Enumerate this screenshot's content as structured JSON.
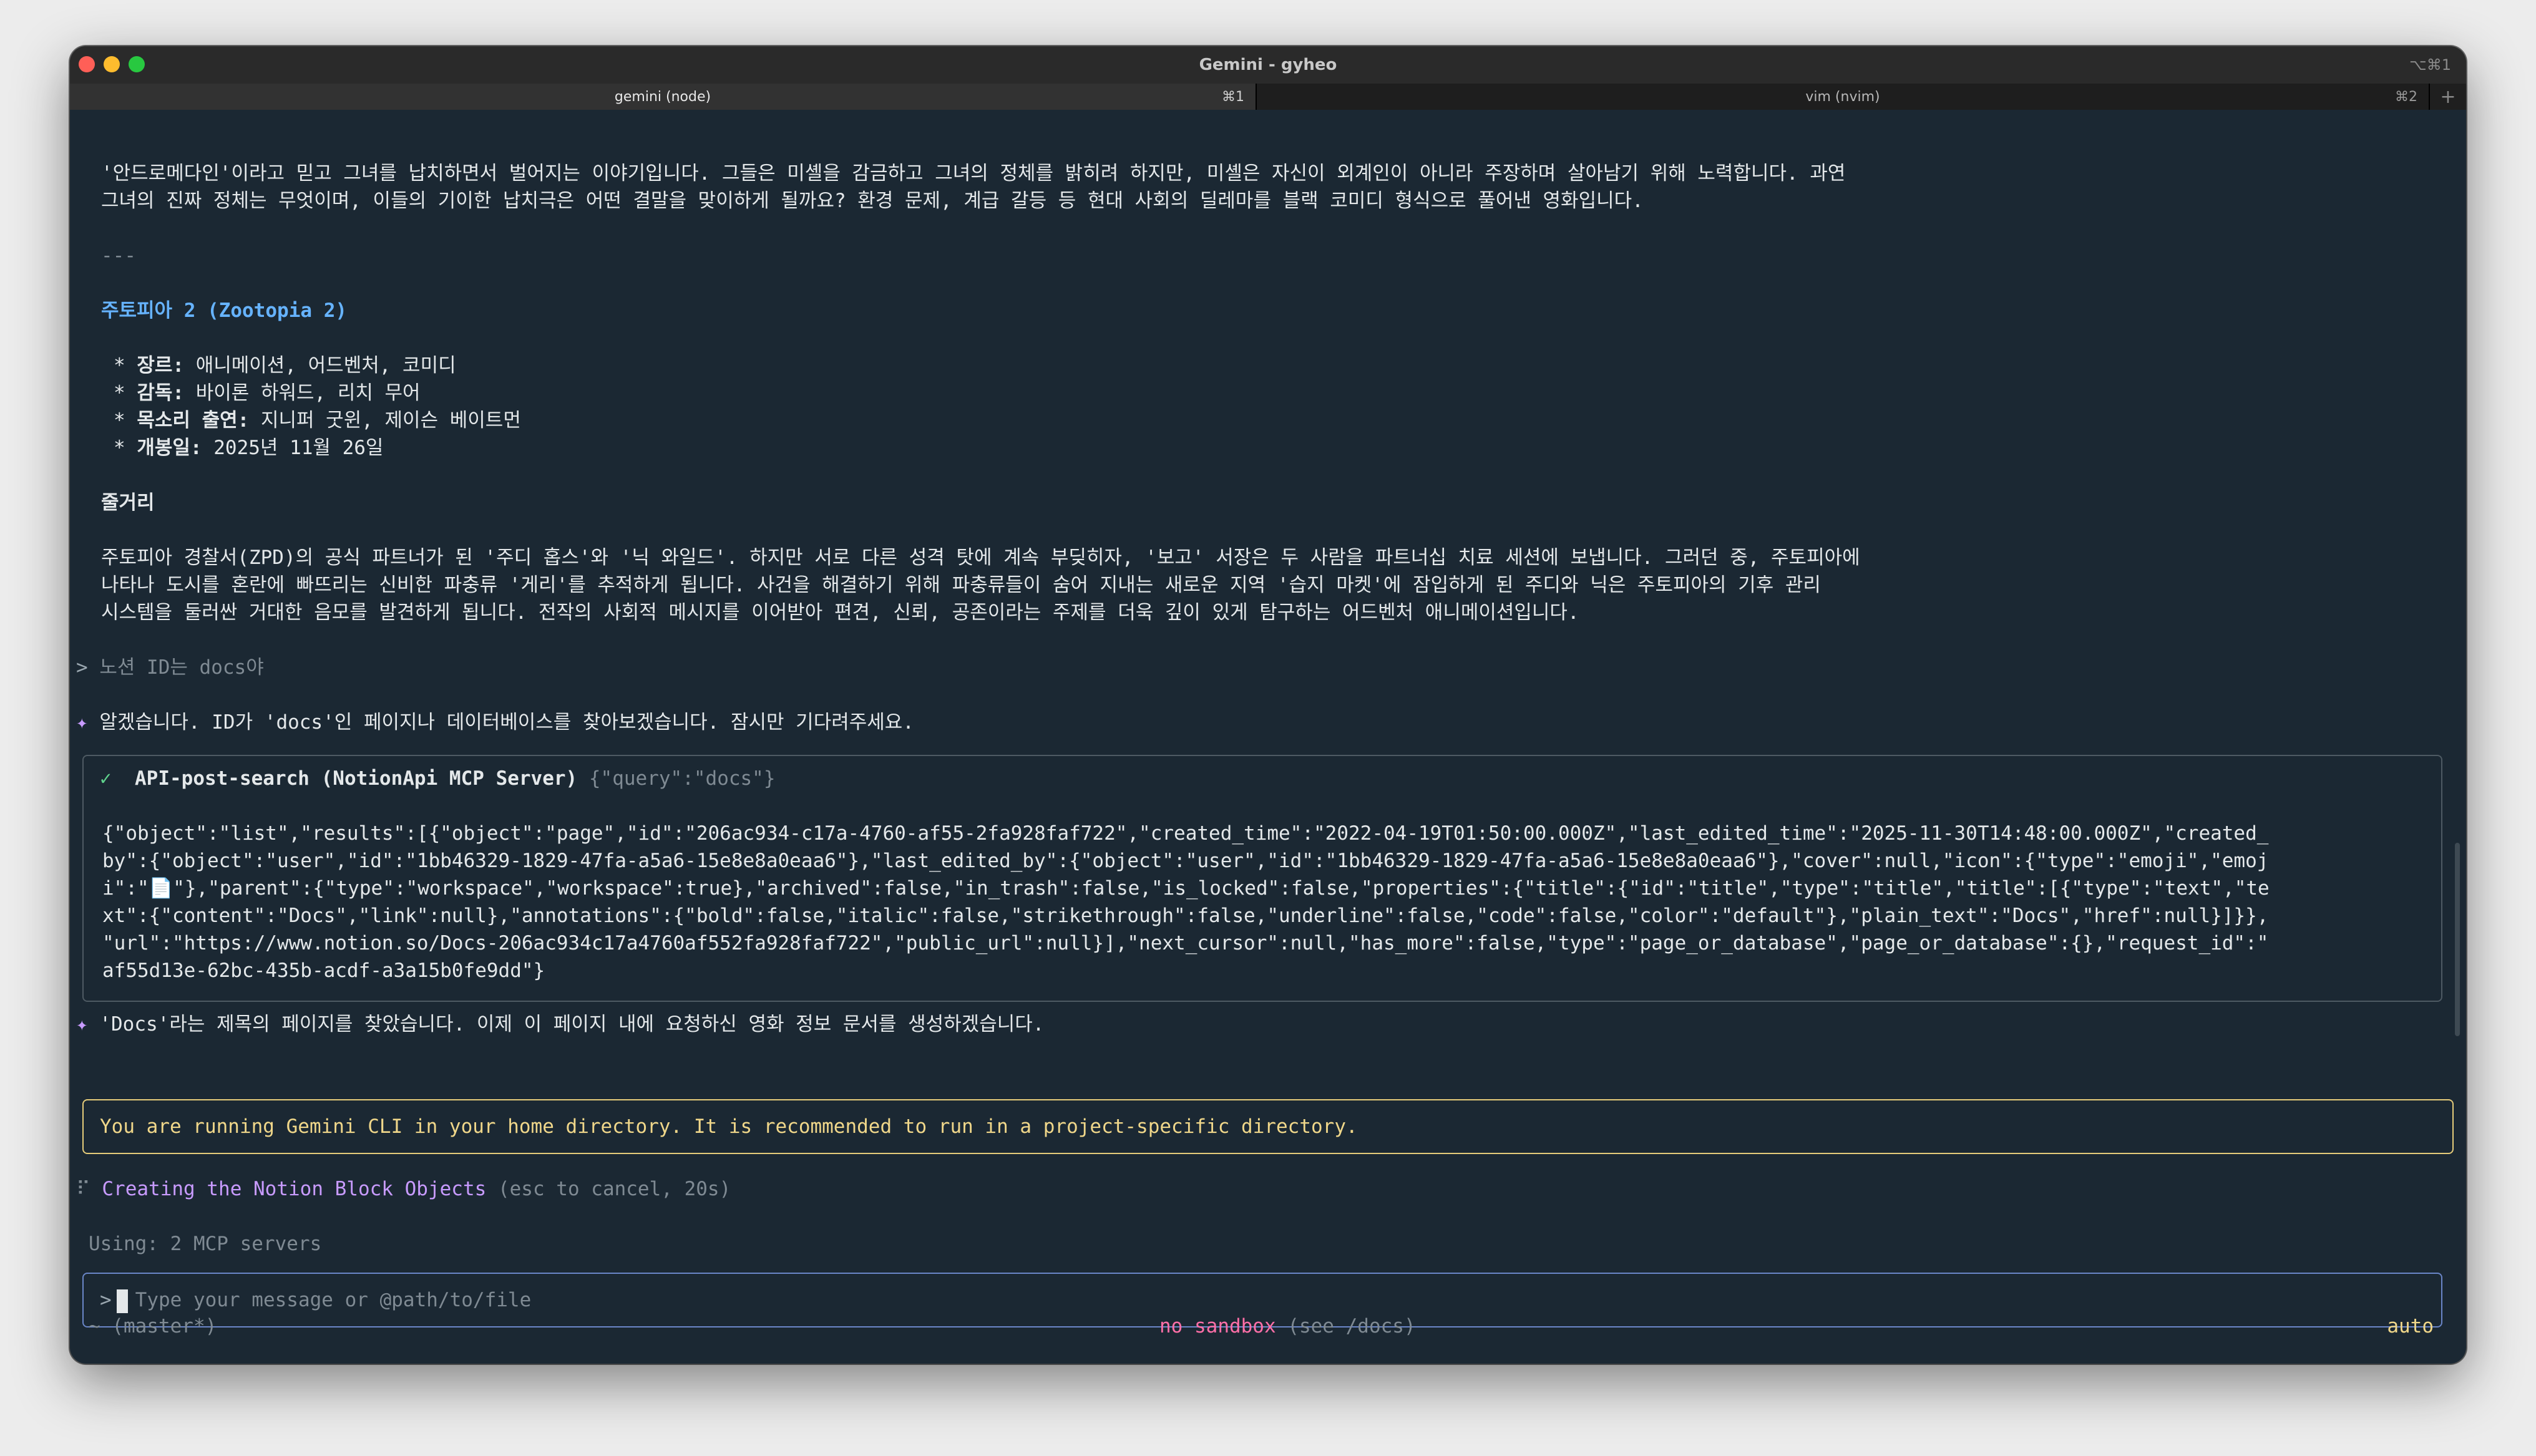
{
  "window": {
    "title": "Gemini - gyheo",
    "title_shortcut": "⌥⌘1"
  },
  "tabs": [
    {
      "label": "gemini (node)",
      "key": "⌘1",
      "active": true
    },
    {
      "label": "vim (nvim)",
      "key": "⌘2",
      "active": false
    }
  ],
  "new_tab_label": "+",
  "content": {
    "intro_line1": "'안드로메다인'이라고 믿고 그녀를 납치하면서 벌어지는 이야기입니다. 그들은 미셸을 감금하고 그녀의 정체를 밝히려 하지만, 미셸은 자신이 외계인이 아니라 주장하며 살아남기 위해 노력합니다. 과연",
    "intro_line2": "그녀의 진짜 정체는 무엇이며, 이들의 기이한 납치극은 어떤 결말을 맞이하게 될까요? 환경 문제, 계급 갈등 등 현대 사회의 딜레마를 블랙 코미디 형식으로 풀어낸 영화입니다.",
    "divider": "---",
    "movie_title": "주토피아 2 (Zootopia 2)",
    "details": [
      {
        "bullet": "*",
        "label": "장르:",
        "value": " 애니메이션, 어드벤처, 코미디"
      },
      {
        "bullet": "*",
        "label": "감독:",
        "value": " 바이론 하워드, 리치 무어"
      },
      {
        "bullet": "*",
        "label": "목소리 출연:",
        "value": " 지니퍼 굿윈, 제이슨 베이트먼"
      },
      {
        "bullet": "*",
        "label": "개봉일:",
        "value": " 2025년 11월 26일"
      }
    ],
    "plot_heading": "줄거리",
    "plot_lines": [
      "주토피아 경찰서(ZPD)의 공식 파트너가 된 '주디 홉스'와 '닉 와일드'. 하지만 서로 다른 성격 탓에 계속 부딪히자, '보고' 서장은 두 사람을 파트너십 치료 세션에 보냅니다. 그러던 중, 주토피아에",
      "나타나 도시를 혼란에 빠뜨리는 신비한 파충류 '게리'를 추적하게 됩니다. 사건을 해결하기 위해 파충류들이 숨어 지내는 새로운 지역 '습지 마켓'에 잠입하게 된 주디와 닉은 주토피아의 기후 관리",
      "시스템을 둘러싼 거대한 음모를 발견하게 됩니다. 전작의 사회적 메시지를 이어받아 편견, 신뢰, 공존이라는 주제를 더욱 깊이 있게 탐구하는 어드벤처 애니메이션입니다."
    ],
    "user_prompt_symbol": ">",
    "user_prompt_text": "노션 ID는 docs야",
    "assistant_symbol": "✦",
    "assistant_reply1": "알겠습니다. ID가 'docs'인 페이지나 데이터베이스를 찾아보겠습니다. 잠시만 기다려주세요.",
    "tool_call": {
      "check": "✓",
      "name": "API-post-search (NotionApi MCP Server)",
      "args": "{\"query\":\"docs\"}",
      "result_lines": [
        "{\"object\":\"list\",\"results\":[{\"object\":\"page\",\"id\":\"206ac934-c17a-4760-af55-2fa928faf722\",\"created_time\":\"2022-04-19T01:50:00.000Z\",\"last_edited_time\":\"2025-11-30T14:48:00.000Z\",\"created_",
        "by\":{\"object\":\"user\",\"id\":\"1bb46329-1829-47fa-a5a6-15e8e8a0eaa6\"},\"last_edited_by\":{\"object\":\"user\",\"id\":\"1bb46329-1829-47fa-a5a6-15e8e8a0eaa6\"},\"cover\":null,\"icon\":{\"type\":\"emoji\",\"emoj",
        "i\":\"📄\"},\"parent\":{\"type\":\"workspace\",\"workspace\":true},\"archived\":false,\"in_trash\":false,\"is_locked\":false,\"properties\":{\"title\":{\"id\":\"title\",\"type\":\"title\",\"title\":[{\"type\":\"text\",\"te",
        "xt\":{\"content\":\"Docs\",\"link\":null},\"annotations\":{\"bold\":false,\"italic\":false,\"strikethrough\":false,\"underline\":false,\"code\":false,\"color\":\"default\"},\"plain_text\":\"Docs\",\"href\":null}]}},",
        "\"url\":\"https://www.notion.so/Docs-206ac934c17a4760af552fa928faf722\",\"public_url\":null}],\"next_cursor\":null,\"has_more\":false,\"type\":\"page_or_database\",\"page_or_database\":{},\"request_id\":\"",
        "af55d13e-62bc-435b-acdf-a3a15b0fe9dd\"}"
      ]
    },
    "assistant_reply2": "'Docs'라는 제목의 페이지를 찾았습니다. 이제 이 페이지 내에 요청하신 영화 정보 문서를 생성하겠습니다.",
    "warning": "You are running Gemini CLI in your home directory. It is recommended to run in a project-specific directory.",
    "spinner": "⠏",
    "status_task": "Creating the Notion Block Objects",
    "status_hint": "(esc to cancel, 20s)",
    "using_line": "Using: 2 MCP servers",
    "input_prompt": ">",
    "input_placeholder": "Type your message or @path/to/file"
  },
  "footer": {
    "cwd": "~ (master*)",
    "sandbox": "no sandbox",
    "sandbox_hint": "(see /docs)",
    "mode": "auto"
  },
  "colors": {
    "background": "#1b2833",
    "heading": "#66b3ff",
    "warning": "#f0d78a",
    "accent_purple": "#c89bff",
    "sandbox_pink": "#ff6fa8"
  }
}
